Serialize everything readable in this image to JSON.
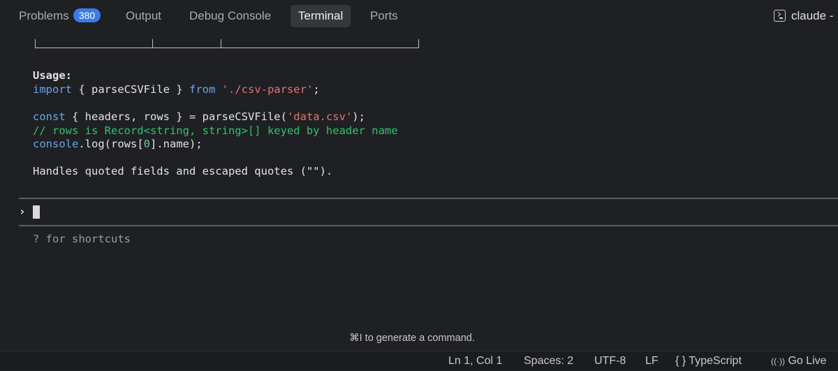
{
  "panel_tabs": [
    {
      "label": "Problems",
      "badge": "380"
    },
    {
      "label": "Output"
    },
    {
      "label": "Debug Console"
    },
    {
      "label": "Terminal",
      "active": true
    },
    {
      "label": "Ports"
    }
  ],
  "terminal_instance": {
    "name": "claude -",
    "icon": "terminal-icon"
  },
  "output": {
    "usage_heading": "Usage:",
    "import_line": {
      "kw1": "import",
      "mid": " { parseCSVFile } ",
      "kw2": "from",
      "sp": " ",
      "str": "'./csv-parser'",
      "end": ";"
    },
    "const_line": {
      "kw": "const",
      "mid": " { headers, rows } = parseCSVFile(",
      "str": "'data.csv'",
      "end": ");"
    },
    "comment_line": "// rows is Record<string, string>[] keyed by header name",
    "console_line": {
      "obj": "console",
      "pre": ".log(rows[",
      "num": "0",
      "post": "].name);"
    },
    "note_line": "Handles quoted fields and escaped quotes (\"\")."
  },
  "prompt": {
    "chevron": "›",
    "hint": "? for shortcuts"
  },
  "generate_hint": "⌘I to generate a command.",
  "status_bar": {
    "position": "Ln 1, Col 1",
    "spaces": "Spaces: 2",
    "encoding": "UTF-8",
    "eol": "LF",
    "language_icon": "{ }",
    "language": "TypeScript",
    "go_live_icon": "((·))",
    "go_live": "Go Live"
  },
  "colors": {
    "keyword": "#6aa6e6",
    "string": "#e0736f",
    "comment": "#2fc46a",
    "badge": "#3b7be8"
  }
}
